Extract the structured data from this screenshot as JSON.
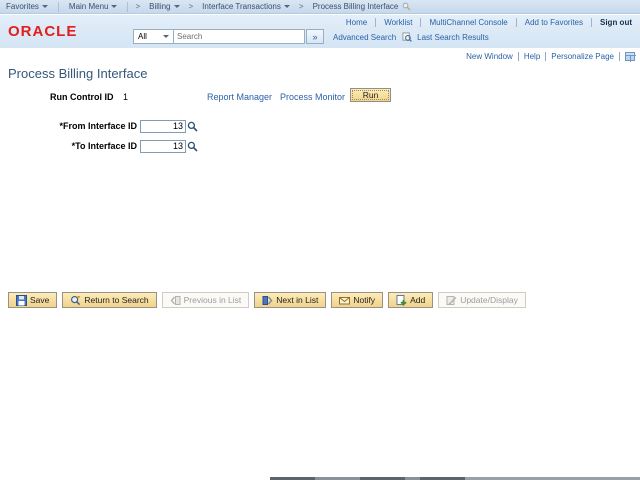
{
  "breadcrumb": {
    "favorites": "Favorites",
    "main_menu": "Main Menu",
    "separator": ">",
    "crumbs": [
      {
        "label": "Billing"
      },
      {
        "label": "Interface Transactions"
      },
      {
        "label": "Process Billing Interface"
      }
    ]
  },
  "header": {
    "logo_text": "ORACLE",
    "search_scope": "All",
    "search_placeholder": "Search",
    "search_go": "»",
    "advanced_search": "Advanced Search",
    "last_search_results": "Last Search Results",
    "nav": {
      "home": "Home",
      "worklist": "Worklist",
      "multichannel": "MultiChannel Console",
      "add_to_favorites": "Add to Favorites",
      "sign_out": "Sign out"
    }
  },
  "pagebar": {
    "new_window": "New Window",
    "help": "Help",
    "personalize_page": "Personalize Page"
  },
  "content": {
    "title": "Process Billing Interface",
    "run_control_label": "Run Control ID",
    "run_control_value": "1",
    "report_manager": "Report Manager",
    "process_monitor": "Process Monitor",
    "run_button": "Run",
    "fields": [
      {
        "label": "*From Interface ID",
        "value": "13"
      },
      {
        "label": "*To Interface ID",
        "value": "13"
      }
    ]
  },
  "toolbar": {
    "buttons": [
      {
        "label": "Save",
        "enabled": true
      },
      {
        "label": "Return to Search",
        "enabled": true
      },
      {
        "label": "Previous in List",
        "enabled": false
      },
      {
        "label": "Next in List",
        "enabled": true
      },
      {
        "label": "Notify",
        "enabled": true
      },
      {
        "label": "Add",
        "enabled": true
      },
      {
        "label": "Update/Display",
        "enabled": false
      }
    ]
  },
  "colors": {
    "oracle_red": "#e01e1e",
    "link_blue": "#2a62a8",
    "button_tan": "#f2d48d",
    "crumb_bar_blue": "#cfe0f0",
    "header_blue": "#dbe8f6"
  }
}
